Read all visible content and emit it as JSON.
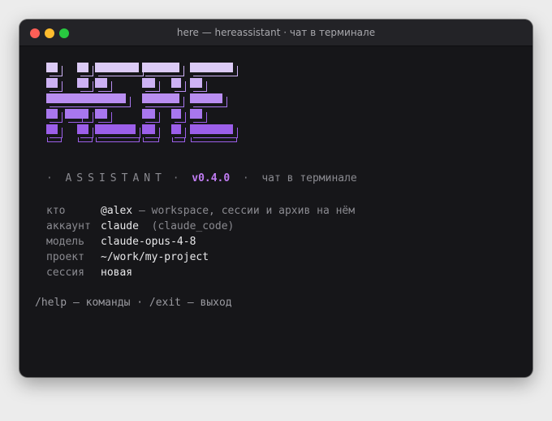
{
  "window": {
    "title": "here — hereassistant · чат в терминале"
  },
  "tagline": {
    "bullet_left": "·",
    "app_name": "ASSISTANT",
    "bullet_mid": "·",
    "version": "v0.4.0",
    "bullet_right": "·",
    "subtitle": "чат в терминале"
  },
  "info": {
    "rows": [
      {
        "key": "кто",
        "value": "@alex",
        "note": " — workspace, сессии и архив на нём"
      },
      {
        "key": "аккаунт",
        "value": "claude",
        "note": "  (claude_code)"
      },
      {
        "key": "модель",
        "value": "claude-opus-4-8",
        "note": ""
      },
      {
        "key": "проект",
        "value": "~/work/my-project",
        "note": ""
      },
      {
        "key": "сессия",
        "value": "новая",
        "note": ""
      }
    ]
  },
  "hint": "/help — команды · /exit — выход",
  "colors": {
    "logo_row_1": "#dccbf6",
    "logo_row_2": "#cdb2f4",
    "logo_row_3": "#b98ef1",
    "logo_row_4": "#a877ee",
    "logo_row_5": "#9c5fe9",
    "version_accent": "#c07cf2",
    "terminal_bg": "#161619"
  },
  "icons": {
    "close": "traffic-light-close-icon",
    "minimize": "traffic-light-minimize-icon",
    "zoom": "traffic-light-zoom-icon",
    "logo": "ascii-art-logo"
  }
}
